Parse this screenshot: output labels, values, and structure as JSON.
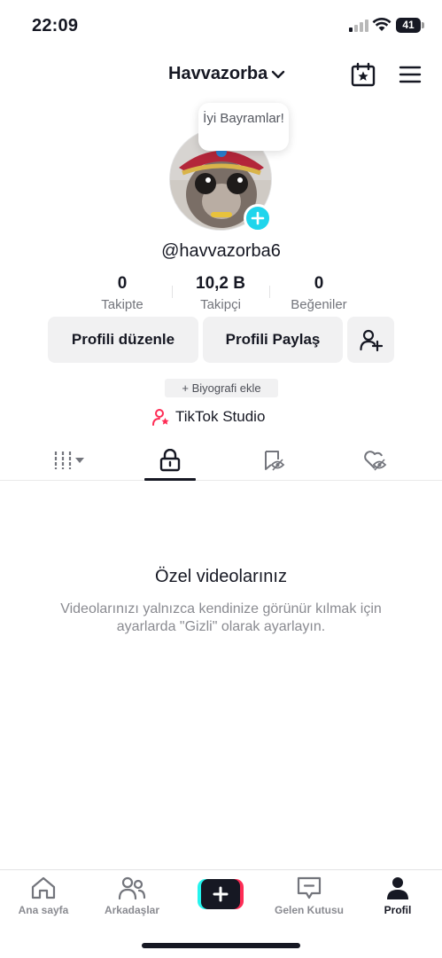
{
  "status_bar": {
    "time": "22:09",
    "battery": "41",
    "icons": [
      "signal-icon",
      "wifi-icon",
      "battery-icon"
    ]
  },
  "header": {
    "username": "Havvazorba",
    "icons": [
      "chevron-down-icon",
      "calendar-star-icon",
      "menu-icon"
    ]
  },
  "profile": {
    "bubble_text": "İyi Bayramlar!",
    "handle": "@havvazorba6",
    "stats": [
      {
        "value": "0",
        "label": "Takipte"
      },
      {
        "value": "10,2 B",
        "label": "Takipçi"
      },
      {
        "value": "0",
        "label": "Beğeniler"
      }
    ],
    "edit_label": "Profili düzenle",
    "share_label": "Profili Paylaş",
    "bio_label": "+ Biyografi ekle",
    "studio_label": "TikTok Studio"
  },
  "tabs": [
    {
      "icon": "grid-videos-icon",
      "active": false
    },
    {
      "icon": "lock-icon",
      "active": true
    },
    {
      "icon": "bookmark-eye-icon",
      "active": false
    },
    {
      "icon": "heart-eye-icon",
      "active": false
    }
  ],
  "empty_state": {
    "title": "Özel videolarınız",
    "description": "Videolarınızı yalnızca kendinize görünür kılmak için ayarlarda \"Gizli\" olarak ayarlayın."
  },
  "bottom_nav": {
    "items": [
      {
        "label": "Ana sayfa",
        "icon": "home-icon"
      },
      {
        "label": "Arkadaşlar",
        "icon": "friends-icon"
      },
      {
        "label": "",
        "icon": "plus-icon"
      },
      {
        "label": "Gelen Kutusu",
        "icon": "inbox-icon"
      },
      {
        "label": "Profil",
        "icon": "profile-icon"
      }
    ],
    "active": "Profil"
  },
  "colors": {
    "accent_cyan": "#20d5ec",
    "brand_pink": "#fe2c55",
    "brand_cyan": "#25f4ee",
    "text_primary": "#161823",
    "text_secondary": "#73757c",
    "button_bg": "#f1f1f2"
  }
}
